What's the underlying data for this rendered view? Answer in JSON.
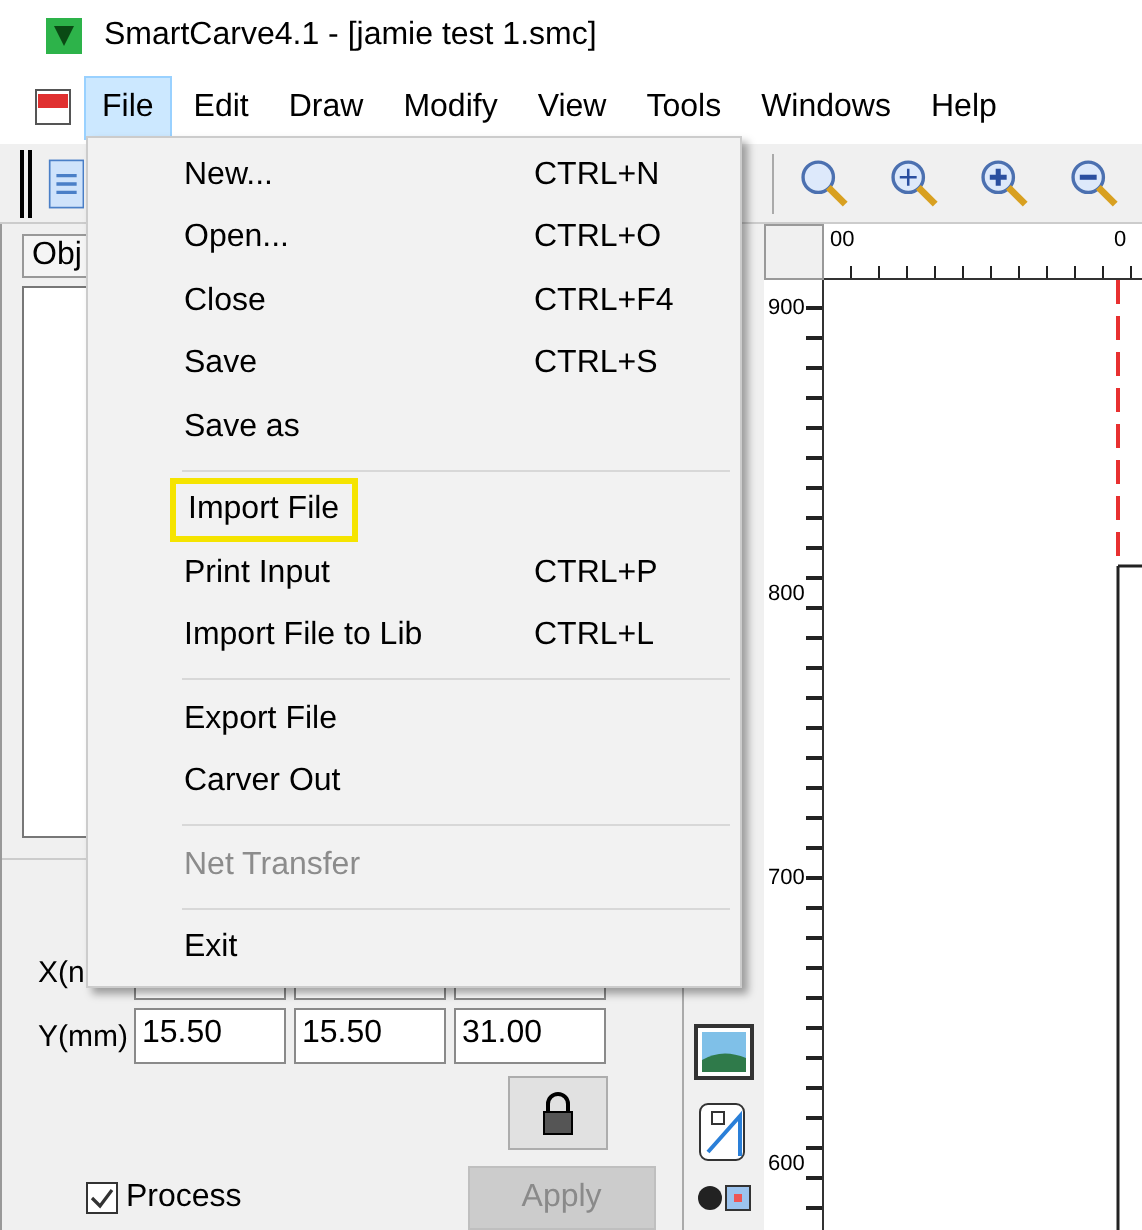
{
  "window": {
    "title": "SmartCarve4.1 - [jamie test 1.smc]"
  },
  "menu_bar": [
    {
      "label": "File",
      "selected": true
    },
    {
      "label": "Edit",
      "selected": false
    },
    {
      "label": "Draw",
      "selected": false
    },
    {
      "label": "Modify",
      "selected": false
    },
    {
      "label": "View",
      "selected": false
    },
    {
      "label": "Tools",
      "selected": false
    },
    {
      "label": "Windows",
      "selected": false
    },
    {
      "label": "Help",
      "selected": false
    }
  ],
  "file_menu": {
    "items": [
      {
        "kind": "item",
        "label": "New...",
        "shortcut": "CTRL+N",
        "disabled": false,
        "highlighted": false
      },
      {
        "kind": "item",
        "label": "Open...",
        "shortcut": "CTRL+O",
        "disabled": false,
        "highlighted": false
      },
      {
        "kind": "item",
        "label": "Close",
        "shortcut": "CTRL+F4",
        "disabled": false,
        "highlighted": false
      },
      {
        "kind": "item",
        "label": "Save",
        "shortcut": "CTRL+S",
        "disabled": false,
        "highlighted": false
      },
      {
        "kind": "item",
        "label": "Save as",
        "disabled": false,
        "highlighted": false
      },
      {
        "kind": "separator"
      },
      {
        "kind": "item",
        "label": "Import File",
        "disabled": false,
        "highlighted": true
      },
      {
        "kind": "item",
        "label": "Print Input",
        "shortcut": "CTRL+P",
        "disabled": false,
        "highlighted": false
      },
      {
        "kind": "item",
        "label": "Import File to Lib",
        "shortcut": "CTRL+L",
        "disabled": false,
        "highlighted": false
      },
      {
        "kind": "separator"
      },
      {
        "kind": "item",
        "label": "Export File",
        "disabled": false,
        "highlighted": false
      },
      {
        "kind": "item",
        "label": "Carver Out",
        "disabled": false,
        "highlighted": false
      },
      {
        "kind": "separator"
      },
      {
        "kind": "item",
        "label": "Net Transfer",
        "disabled": true,
        "highlighted": false
      },
      {
        "kind": "separator"
      },
      {
        "kind": "item",
        "label": "Exit",
        "disabled": false,
        "highlighted": false
      }
    ]
  },
  "object_panel": {
    "tab": "Obj",
    "x_label": "X(n",
    "y_label": "Y(mm)",
    "y_values": [
      "15.50",
      "15.50",
      "31.00"
    ],
    "process": {
      "label": "Process",
      "checked": true
    },
    "apply": {
      "label": "Apply",
      "disabled": true
    }
  },
  "ruler": {
    "top_labels": [
      "00",
      "0"
    ],
    "side_labels": [
      "900",
      "800",
      "700",
      "600"
    ]
  }
}
